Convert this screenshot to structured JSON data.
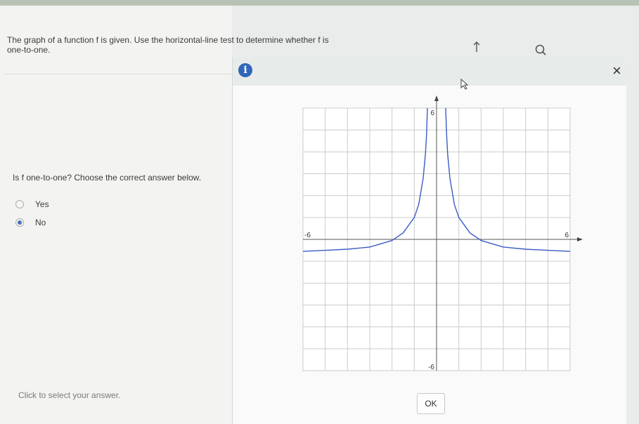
{
  "question": {
    "prompt_line1": "The graph of a function f is given.  Use the horizontal-line test to determine whether f is",
    "prompt_line2": "one-to-one.",
    "sub_question": "Is f one-to-one? Choose the correct answer below.",
    "options": [
      {
        "label": "Yes",
        "selected": false
      },
      {
        "label": "No",
        "selected": true
      }
    ],
    "hint": "Click to select your answer."
  },
  "toolbar": {
    "cursor_icon": "pointer-arrow-icon",
    "zoom_icon": "magnifier-icon"
  },
  "popup": {
    "info_icon": "i",
    "close_icon": "×",
    "ok_label": "OK"
  },
  "chart_data": {
    "type": "line",
    "xlim": [
      -6,
      6
    ],
    "ylim": [
      -6,
      6
    ],
    "grid": true,
    "x_tick_labels": [
      "-6",
      "6"
    ],
    "y_tick_labels": [
      "6",
      "-6"
    ],
    "series": [
      {
        "color": "#3b5bc4",
        "x": [
          -6,
          -5,
          -4,
          -3,
          -2,
          -1.5,
          -1,
          -0.8,
          -0.6,
          -0.5,
          -0.45,
          -0.41,
          0.41,
          0.45,
          0.5,
          0.6,
          0.8,
          1,
          1.5,
          2,
          3,
          4,
          5,
          6
        ],
        "y": [
          -0.55,
          -0.5,
          -0.45,
          -0.35,
          -0.05,
          0.3,
          1,
          1.6,
          2.8,
          3.9,
          4.8,
          6,
          6,
          4.8,
          3.9,
          2.8,
          1.6,
          1,
          0.3,
          -0.05,
          -0.35,
          -0.45,
          -0.5,
          -0.55
        ]
      }
    ]
  }
}
